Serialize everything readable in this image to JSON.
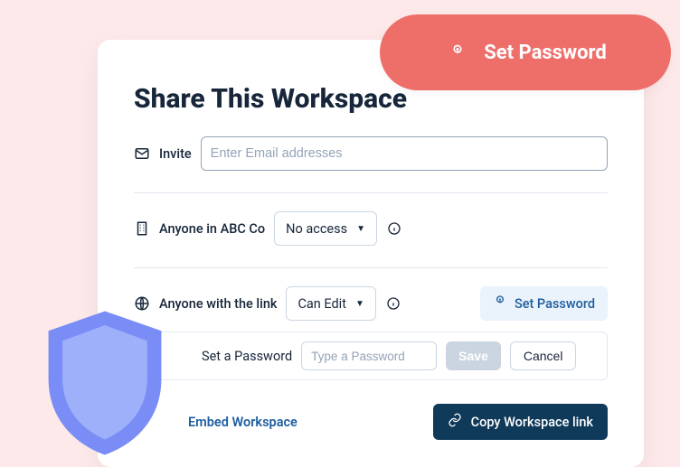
{
  "banner": {
    "label": "Set Password"
  },
  "dialog": {
    "title": "Share This Workspace",
    "invite": {
      "label": "Invite",
      "placeholder": "Enter Email addresses",
      "value": ""
    },
    "org": {
      "label": "Anyone in ABC Co",
      "access_options_selected": "No access"
    },
    "link": {
      "label": "Anyone with the link",
      "access_options_selected": "Can Edit",
      "set_password_label": "Set Password"
    },
    "password": {
      "label": "Set a Password",
      "placeholder": "Type a Password",
      "value": "",
      "save_label": "Save",
      "cancel_label": "Cancel"
    },
    "footer": {
      "embed_label": "Embed Workspace",
      "copy_label": "Copy Workspace link"
    }
  }
}
